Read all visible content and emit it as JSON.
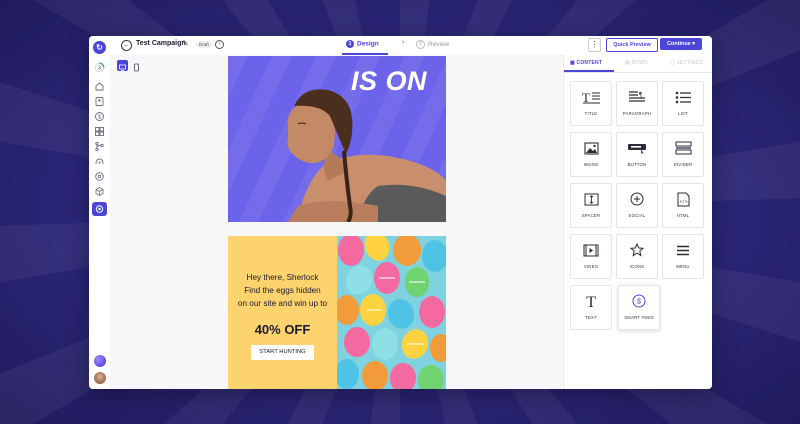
{
  "header": {
    "campaign_title": "Test Campaign",
    "draft_badge": "Draft",
    "steps": [
      {
        "number": "1",
        "label": "Design",
        "active": true
      },
      {
        "number": "2",
        "label": "Review",
        "active": false
      }
    ],
    "more_label": "⋮",
    "quick_preview_label": "Quick Preview",
    "continue_label": "Continue ▾"
  },
  "email": {
    "hero_headline": "IS ON",
    "promo_line1": "Hey there, Sherlock",
    "promo_line2": "Find the eggs hidden",
    "promo_line3": "on our site and win up to",
    "promo_offer": "40% OFF",
    "promo_cta": "START HUNTING"
  },
  "panel": {
    "tabs": [
      {
        "label": "CONTENT",
        "active": true
      },
      {
        "label": "ROWS",
        "active": false
      },
      {
        "label": "SETTINGS",
        "active": false
      }
    ],
    "blocks": [
      {
        "label": "TITLE",
        "icon": "title-icon"
      },
      {
        "label": "PARAGRAPH",
        "icon": "paragraph-icon"
      },
      {
        "label": "LIST",
        "icon": "list-icon"
      },
      {
        "label": "IMAGE",
        "icon": "image-icon"
      },
      {
        "label": "BUTTON",
        "icon": "button-icon"
      },
      {
        "label": "DIVIDER",
        "icon": "divider-icon"
      },
      {
        "label": "SPACER",
        "icon": "spacer-icon"
      },
      {
        "label": "SOCIAL",
        "icon": "social-icon"
      },
      {
        "label": "HTML",
        "icon": "html-icon"
      },
      {
        "label": "VIDEO",
        "icon": "video-icon"
      },
      {
        "label": "ICONS",
        "icon": "star-icon"
      },
      {
        "label": "MENU",
        "icon": "menu-icon"
      },
      {
        "label": "TEXT",
        "icon": "text-icon"
      },
      {
        "label": "SMART FEED",
        "icon": "smart-feed-icon"
      }
    ]
  },
  "colors": {
    "accent": "#4b46d8",
    "hero_bg": "#6b63ea",
    "promo_bg": "#fdd36e",
    "backdrop": "#2b2779"
  }
}
